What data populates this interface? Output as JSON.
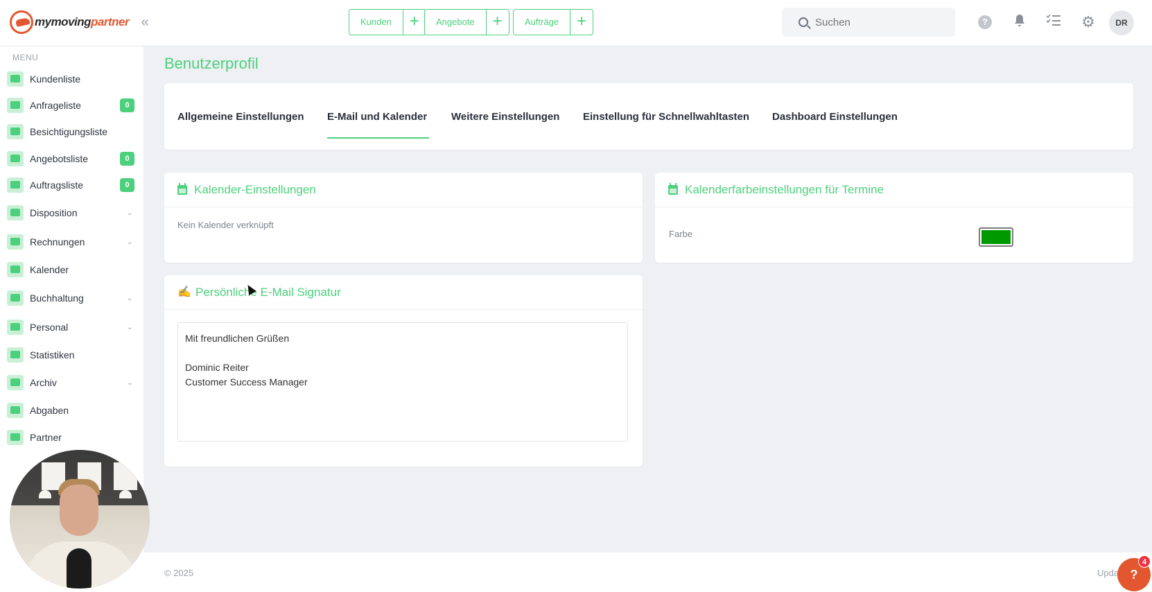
{
  "app": {
    "logo_part1": "mymoving",
    "logo_part2": "partner",
    "collapse_icon": "«"
  },
  "topbar": {
    "quick_actions": [
      {
        "label": "Kunden"
      },
      {
        "label": "Angebote"
      },
      {
        "label": "Aufträge"
      }
    ],
    "plus_glyph": "+",
    "search_placeholder": "Suchen",
    "help_glyph": "?",
    "bell_glyph": "🔔",
    "tasks_glyph": "☰",
    "gear_glyph": "⚙",
    "avatar_initials": "DR"
  },
  "sidebar": {
    "menu_label": "MENU",
    "items": [
      {
        "label": "Kundenliste"
      },
      {
        "label": "Anfrageliste",
        "badge": "0"
      },
      {
        "label": "Besichtigungsliste"
      },
      {
        "label": "Angebotsliste",
        "badge": "0"
      },
      {
        "label": "Auftragsliste",
        "badge": "0"
      },
      {
        "label": "Disposition",
        "chevron": "⌄"
      },
      {
        "label": "Rechnungen",
        "chevron": "⌄"
      },
      {
        "label": "Kalender"
      },
      {
        "label": "Buchhaltung",
        "chevron": "⌄"
      },
      {
        "label": "Personal",
        "chevron": "⌄"
      },
      {
        "label": "Statistiken"
      },
      {
        "label": "Archiv",
        "chevron": "⌄"
      },
      {
        "label": "Abgaben"
      },
      {
        "label": "Partner"
      }
    ]
  },
  "main": {
    "page_title": "Benutzerprofil",
    "tabs": [
      {
        "label": "Allgemeine Einstellungen"
      },
      {
        "label": "E-Mail und Kalender",
        "active": true
      },
      {
        "label": "Weitere Einstellungen"
      },
      {
        "label": "Einstellung für Schnellwahltasten"
      },
      {
        "label": "Dashboard Einstellungen"
      }
    ],
    "calendar_settings": {
      "title": "Kalender-Einstellungen",
      "status_text": "Kein Kalender verknüpft"
    },
    "calendar_color": {
      "title": "Kalenderfarbeinstellungen für Termine",
      "color_label": "Farbe",
      "color_value": "#009900"
    },
    "signature": {
      "title": "Persönliche E-Mail Signatur",
      "lines": [
        "Mit freundlichen Grüßen",
        "",
        "Dominic Reiter",
        "Customer Success Manager"
      ]
    }
  },
  "footer": {
    "copyright": "© 2025",
    "update_text": "Upda",
    "help_glyph": "?",
    "help_badge": "4"
  },
  "colors": {
    "accent": "#4cd07d",
    "brand": "#e2572f"
  }
}
